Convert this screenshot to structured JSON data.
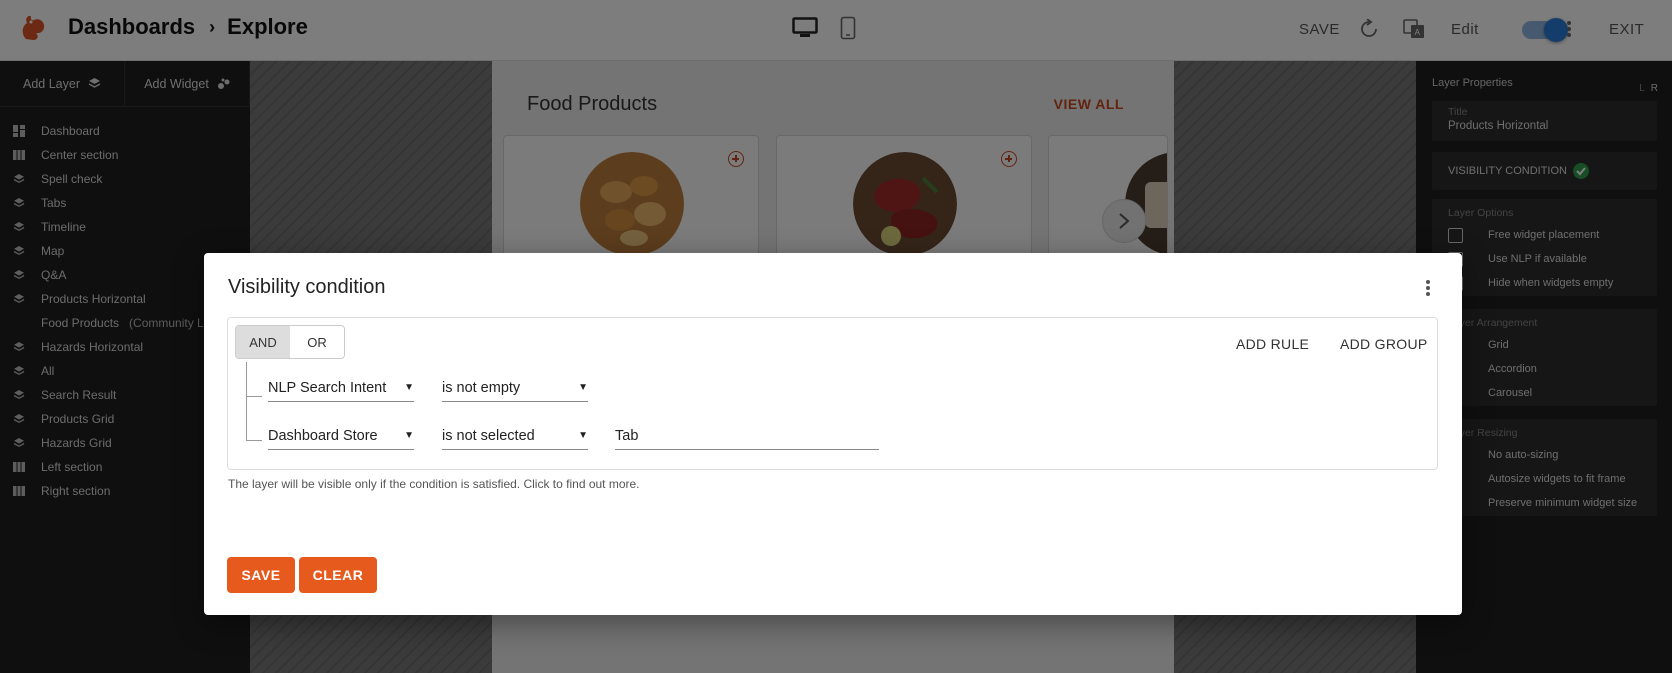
{
  "header": {
    "breadcrumb": [
      "Dashboards",
      "Explore"
    ],
    "separator": "›",
    "save_label": "SAVE",
    "edit_label": "Edit",
    "exit_label": "EXIT",
    "edit_mode_on": true
  },
  "sidebar": {
    "tabs": [
      "Add Layer",
      "Add Widget"
    ],
    "items": [
      {
        "label": "Dashboard",
        "icon": "dashboard-icon"
      },
      {
        "label": "Center section",
        "icon": "section-icon"
      },
      {
        "label": "Spell check",
        "icon": "layers-icon"
      },
      {
        "label": "Tabs",
        "icon": "layers-icon"
      },
      {
        "label": "Timeline",
        "icon": "layers-icon"
      },
      {
        "label": "Map",
        "icon": "layers-icon"
      },
      {
        "label": "Q&A",
        "icon": "layers-icon"
      },
      {
        "label": "Products Horizontal",
        "icon": "layers-icon"
      },
      {
        "label": "Food Products",
        "sub": "(Community List",
        "icon": ""
      },
      {
        "label": "Hazards Horizontal",
        "icon": "layers-icon"
      },
      {
        "label": "All",
        "icon": "layers-icon"
      },
      {
        "label": "Search Result",
        "icon": "layers-icon"
      },
      {
        "label": "Products Grid",
        "icon": "layers-icon"
      },
      {
        "label": "Hazards Grid",
        "icon": "layers-icon"
      },
      {
        "label": "Left section",
        "icon": "section-icon"
      },
      {
        "label": "Right section",
        "icon": "section-icon"
      }
    ]
  },
  "canvas": {
    "section_title": "Food Products",
    "view_all": "VIEW ALL"
  },
  "right_panel": {
    "title": "Layer Properties",
    "lr": [
      "L",
      "R"
    ],
    "title_field_label": "Title",
    "title_field_value": "Products Horizontal",
    "visibility_label": "VISIBILITY CONDITION",
    "layer_options_label": "Layer Options",
    "layer_options": [
      "Free widget placement",
      "Use NLP if available",
      "Hide when widgets empty"
    ],
    "arrangement_label": "Layer Arrangement",
    "arrangement": [
      "Grid",
      "Accordion",
      "Carousel"
    ],
    "resizing_label": "Layer Resizing",
    "resizing": [
      "No auto-sizing",
      "Autosize widgets to fit frame",
      "Preserve minimum widget size"
    ]
  },
  "dialog": {
    "title": "Visibility condition",
    "and_label": "AND",
    "or_label": "OR",
    "add_rule": "ADD RULE",
    "add_group": "ADD GROUP",
    "rules": [
      {
        "field": "NLP Search Intent",
        "operator": "is not empty",
        "value": ""
      },
      {
        "field": "Dashboard Store",
        "operator": "is not selected",
        "value": "Tab"
      }
    ],
    "hint": "The layer will be visible only if the condition is satisfied. Click to find out more.",
    "save_button": "SAVE",
    "clear_button": "CLEAR"
  },
  "colors": {
    "accent": "#e65a1e",
    "toggle": "#2b7bd6",
    "success": "#2e9d4a"
  }
}
